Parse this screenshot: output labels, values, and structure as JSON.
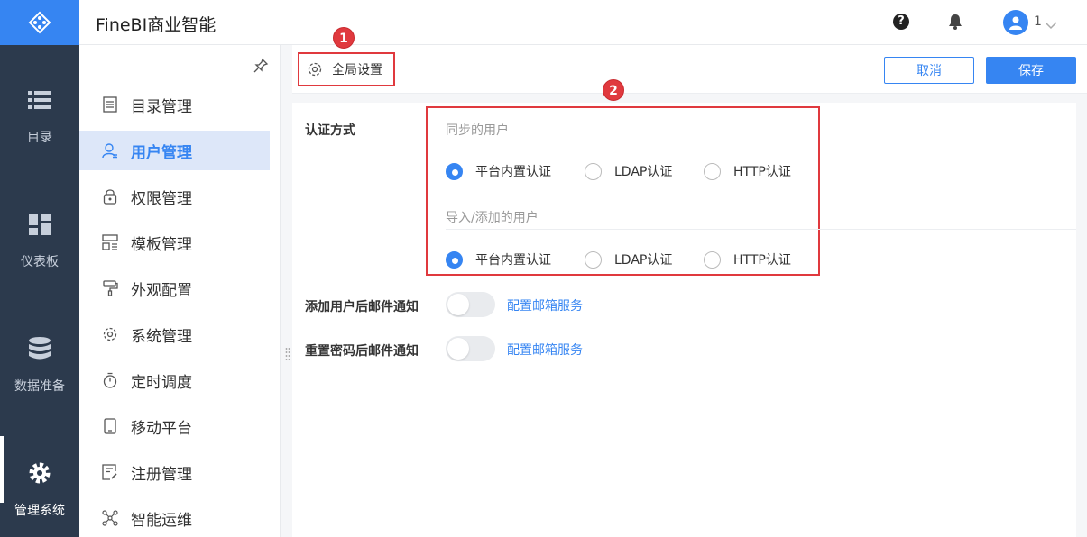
{
  "app": {
    "title": "FineBI商业智能"
  },
  "header": {
    "help_icon": "?",
    "user_name": "1"
  },
  "rail": {
    "items": [
      {
        "label": "目录",
        "icon": "list-icon"
      },
      {
        "label": "仪表板",
        "icon": "dashboard-icon"
      },
      {
        "label": "数据准备",
        "icon": "database-icon"
      },
      {
        "label": "管理系统",
        "icon": "gear-icon",
        "active": true
      }
    ]
  },
  "sidebar": {
    "items": [
      {
        "label": "目录管理",
        "icon": "catalog-icon"
      },
      {
        "label": "用户管理",
        "icon": "user-icon",
        "active": true
      },
      {
        "label": "权限管理",
        "icon": "lock-icon"
      },
      {
        "label": "模板管理",
        "icon": "template-icon"
      },
      {
        "label": "外观配置",
        "icon": "paint-roller-icon"
      },
      {
        "label": "系统管理",
        "icon": "gear-icon"
      },
      {
        "label": "定时调度",
        "icon": "stopwatch-icon"
      },
      {
        "label": "移动平台",
        "icon": "tablet-icon"
      },
      {
        "label": "注册管理",
        "icon": "register-icon"
      },
      {
        "label": "智能运维",
        "icon": "network-icon"
      }
    ]
  },
  "toolbar": {
    "tab_label": "全局设置",
    "cancel_label": "取消",
    "save_label": "保存"
  },
  "callouts": [
    "1",
    "2"
  ],
  "auth": {
    "label": "认证方式",
    "sync_group": {
      "title": "同步的用户",
      "options": [
        "平台内置认证",
        "LDAP认证",
        "HTTP认证"
      ],
      "selected": "平台内置认证"
    },
    "import_group": {
      "title": "导入/添加的用户",
      "options": [
        "平台内置认证",
        "LDAP认证",
        "HTTP认证"
      ],
      "selected": "平台内置认证"
    }
  },
  "notifications": [
    {
      "label": "添加用户后邮件通知",
      "enabled": false,
      "link": "配置邮箱服务"
    },
    {
      "label": "重置密码后邮件通知",
      "enabled": false,
      "link": "配置邮箱服务"
    }
  ],
  "colors": {
    "accent": "#3685f2",
    "rail_bg": "#2c3a4d",
    "highlight": "#e0393e"
  }
}
